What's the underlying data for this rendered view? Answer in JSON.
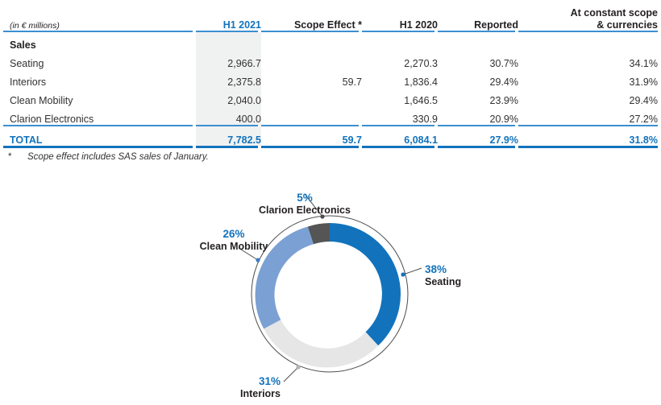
{
  "table": {
    "unit_label": "(in € millions)",
    "columns": [
      "H1 2021",
      "Scope Effect *",
      "H1 2020",
      "Reported",
      "At constant scope & currencies"
    ],
    "column_constant_line1": "At constant scope",
    "column_constant_line2": "& currencies",
    "section_label": "Sales",
    "rows": [
      {
        "label": "Seating",
        "h1_2021": "2,966.7",
        "scope_effect": "",
        "h1_2020": "2,270.3",
        "reported": "30.7%",
        "constant": "34.1%"
      },
      {
        "label": "Interiors",
        "h1_2021": "2,375.8",
        "scope_effect": "59.7",
        "h1_2020": "1,836.4",
        "reported": "29.4%",
        "constant": "31.9%"
      },
      {
        "label": "Clean Mobility",
        "h1_2021": "2,040.0",
        "scope_effect": "",
        "h1_2020": "1,646.5",
        "reported": "23.9%",
        "constant": "29.4%"
      },
      {
        "label": "Clarion Electronics",
        "h1_2021": "400.0",
        "scope_effect": "",
        "h1_2020": "330.9",
        "reported": "20.9%",
        "constant": "27.2%"
      }
    ],
    "total": {
      "label": "TOTAL",
      "h1_2021": "7,782.5",
      "scope_effect": "59.7",
      "h1_2020": "6,084.1",
      "reported": "27.9%",
      "constant": "31.8%"
    }
  },
  "footnote": {
    "marker": "*",
    "text": "Scope effect includes SAS sales of January."
  },
  "chart_data": {
    "type": "pie",
    "title": "",
    "variant": "donut",
    "legend": "labels-with-leader-lines",
    "categories": [
      "Seating",
      "Interiors",
      "Clean Mobility",
      "Clarion Electronics"
    ],
    "values": [
      38,
      31,
      26,
      5
    ],
    "labels": [
      "38%",
      "31%",
      "26%",
      "5%"
    ],
    "colors": [
      "#1273bc",
      "#e6e6e6",
      "#7ba0d4",
      "#555555"
    ],
    "label_color": "#1273bc",
    "name_color": "#231f20"
  },
  "colors": {
    "accent_blue": "#1273bc",
    "rule_blue": "#3b8fd0",
    "band_gray": "#f0f1f1",
    "text_dark": "#231f20",
    "seating": "#1273bc",
    "interiors": "#e6e6e6",
    "clean_mobility": "#7ba0d4",
    "clarion_electronics": "#555555"
  }
}
